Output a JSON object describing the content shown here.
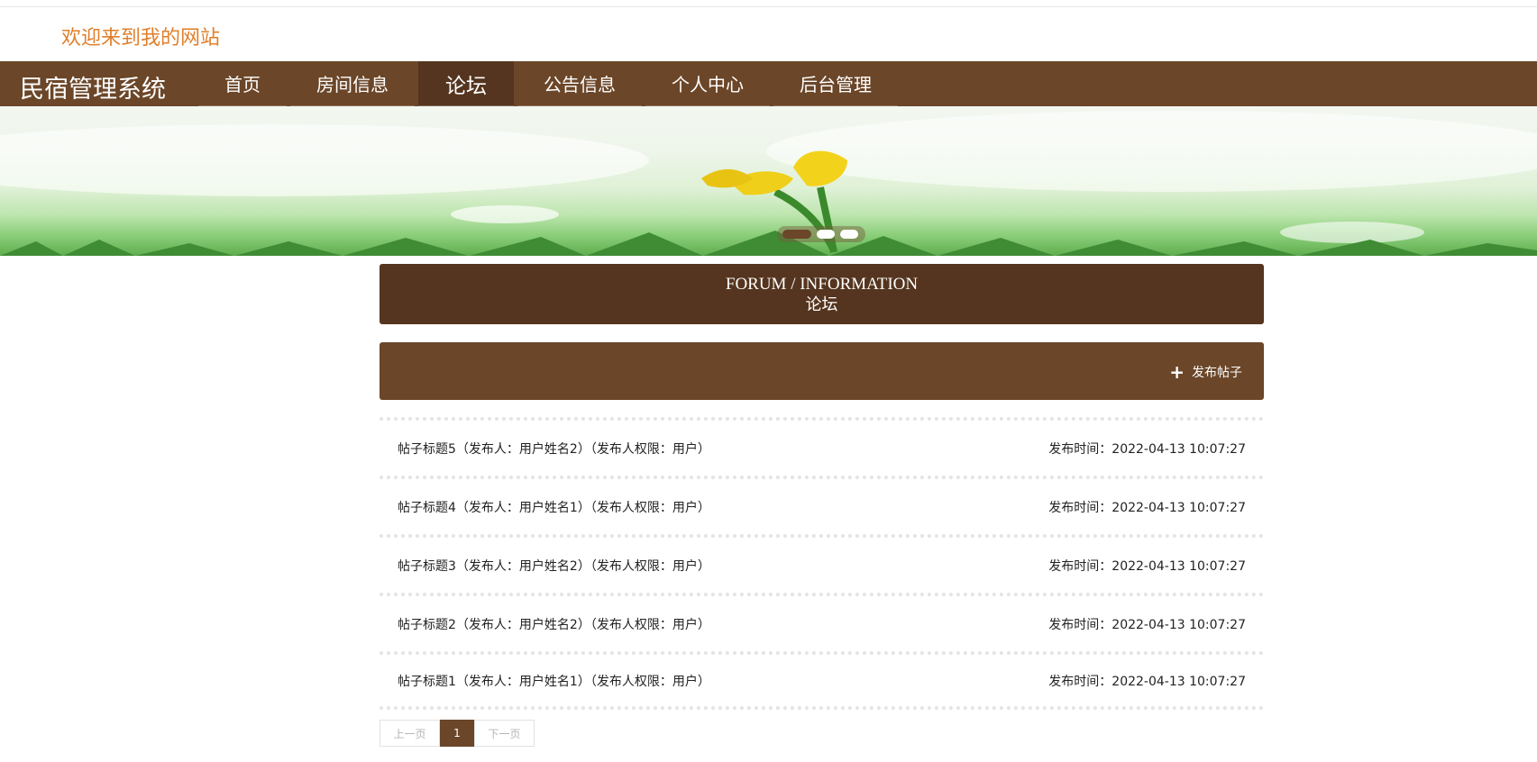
{
  "header": {
    "welcome": "欢迎来到我的网站"
  },
  "navbar": {
    "brand": "民宿管理系统",
    "items": [
      {
        "label": "首页"
      },
      {
        "label": "房间信息"
      },
      {
        "label": "论坛",
        "active": true
      },
      {
        "label": "公告信息"
      },
      {
        "label": "个人中心"
      },
      {
        "label": "后台管理"
      }
    ]
  },
  "banner": {
    "slides": 3,
    "active_slide": 1
  },
  "section": {
    "title_en": "FORUM / INFORMATION",
    "title_cn": "论坛"
  },
  "actions": {
    "post_label": "发布帖子",
    "post_icon": "plus-icon"
  },
  "posts": [
    {
      "title": "帖子标题5（发布人：用户姓名2）（发布人权限：用户）",
      "time": "发布时间：2022-04-13 10:07:27"
    },
    {
      "title": "帖子标题4（发布人：用户姓名1）（发布人权限：用户）",
      "time": "发布时间：2022-04-13 10:07:27"
    },
    {
      "title": "帖子标题3（发布人：用户姓名2）（发布人权限：用户）",
      "time": "发布时间：2022-04-13 10:07:27"
    },
    {
      "title": "帖子标题2（发布人：用户姓名2）（发布人权限：用户）",
      "time": "发布时间：2022-04-13 10:07:27"
    },
    {
      "title": "帖子标题1（发布人：用户姓名1）（发布人权限：用户）",
      "time": "发布时间：2022-04-13 10:07:27"
    }
  ],
  "pagination": {
    "prev": "上一页",
    "current": "1",
    "next": "下一页"
  },
  "colors": {
    "brown": "#6b4628",
    "dark_brown": "#55351f",
    "welcome_orange": "#e07f2a"
  }
}
